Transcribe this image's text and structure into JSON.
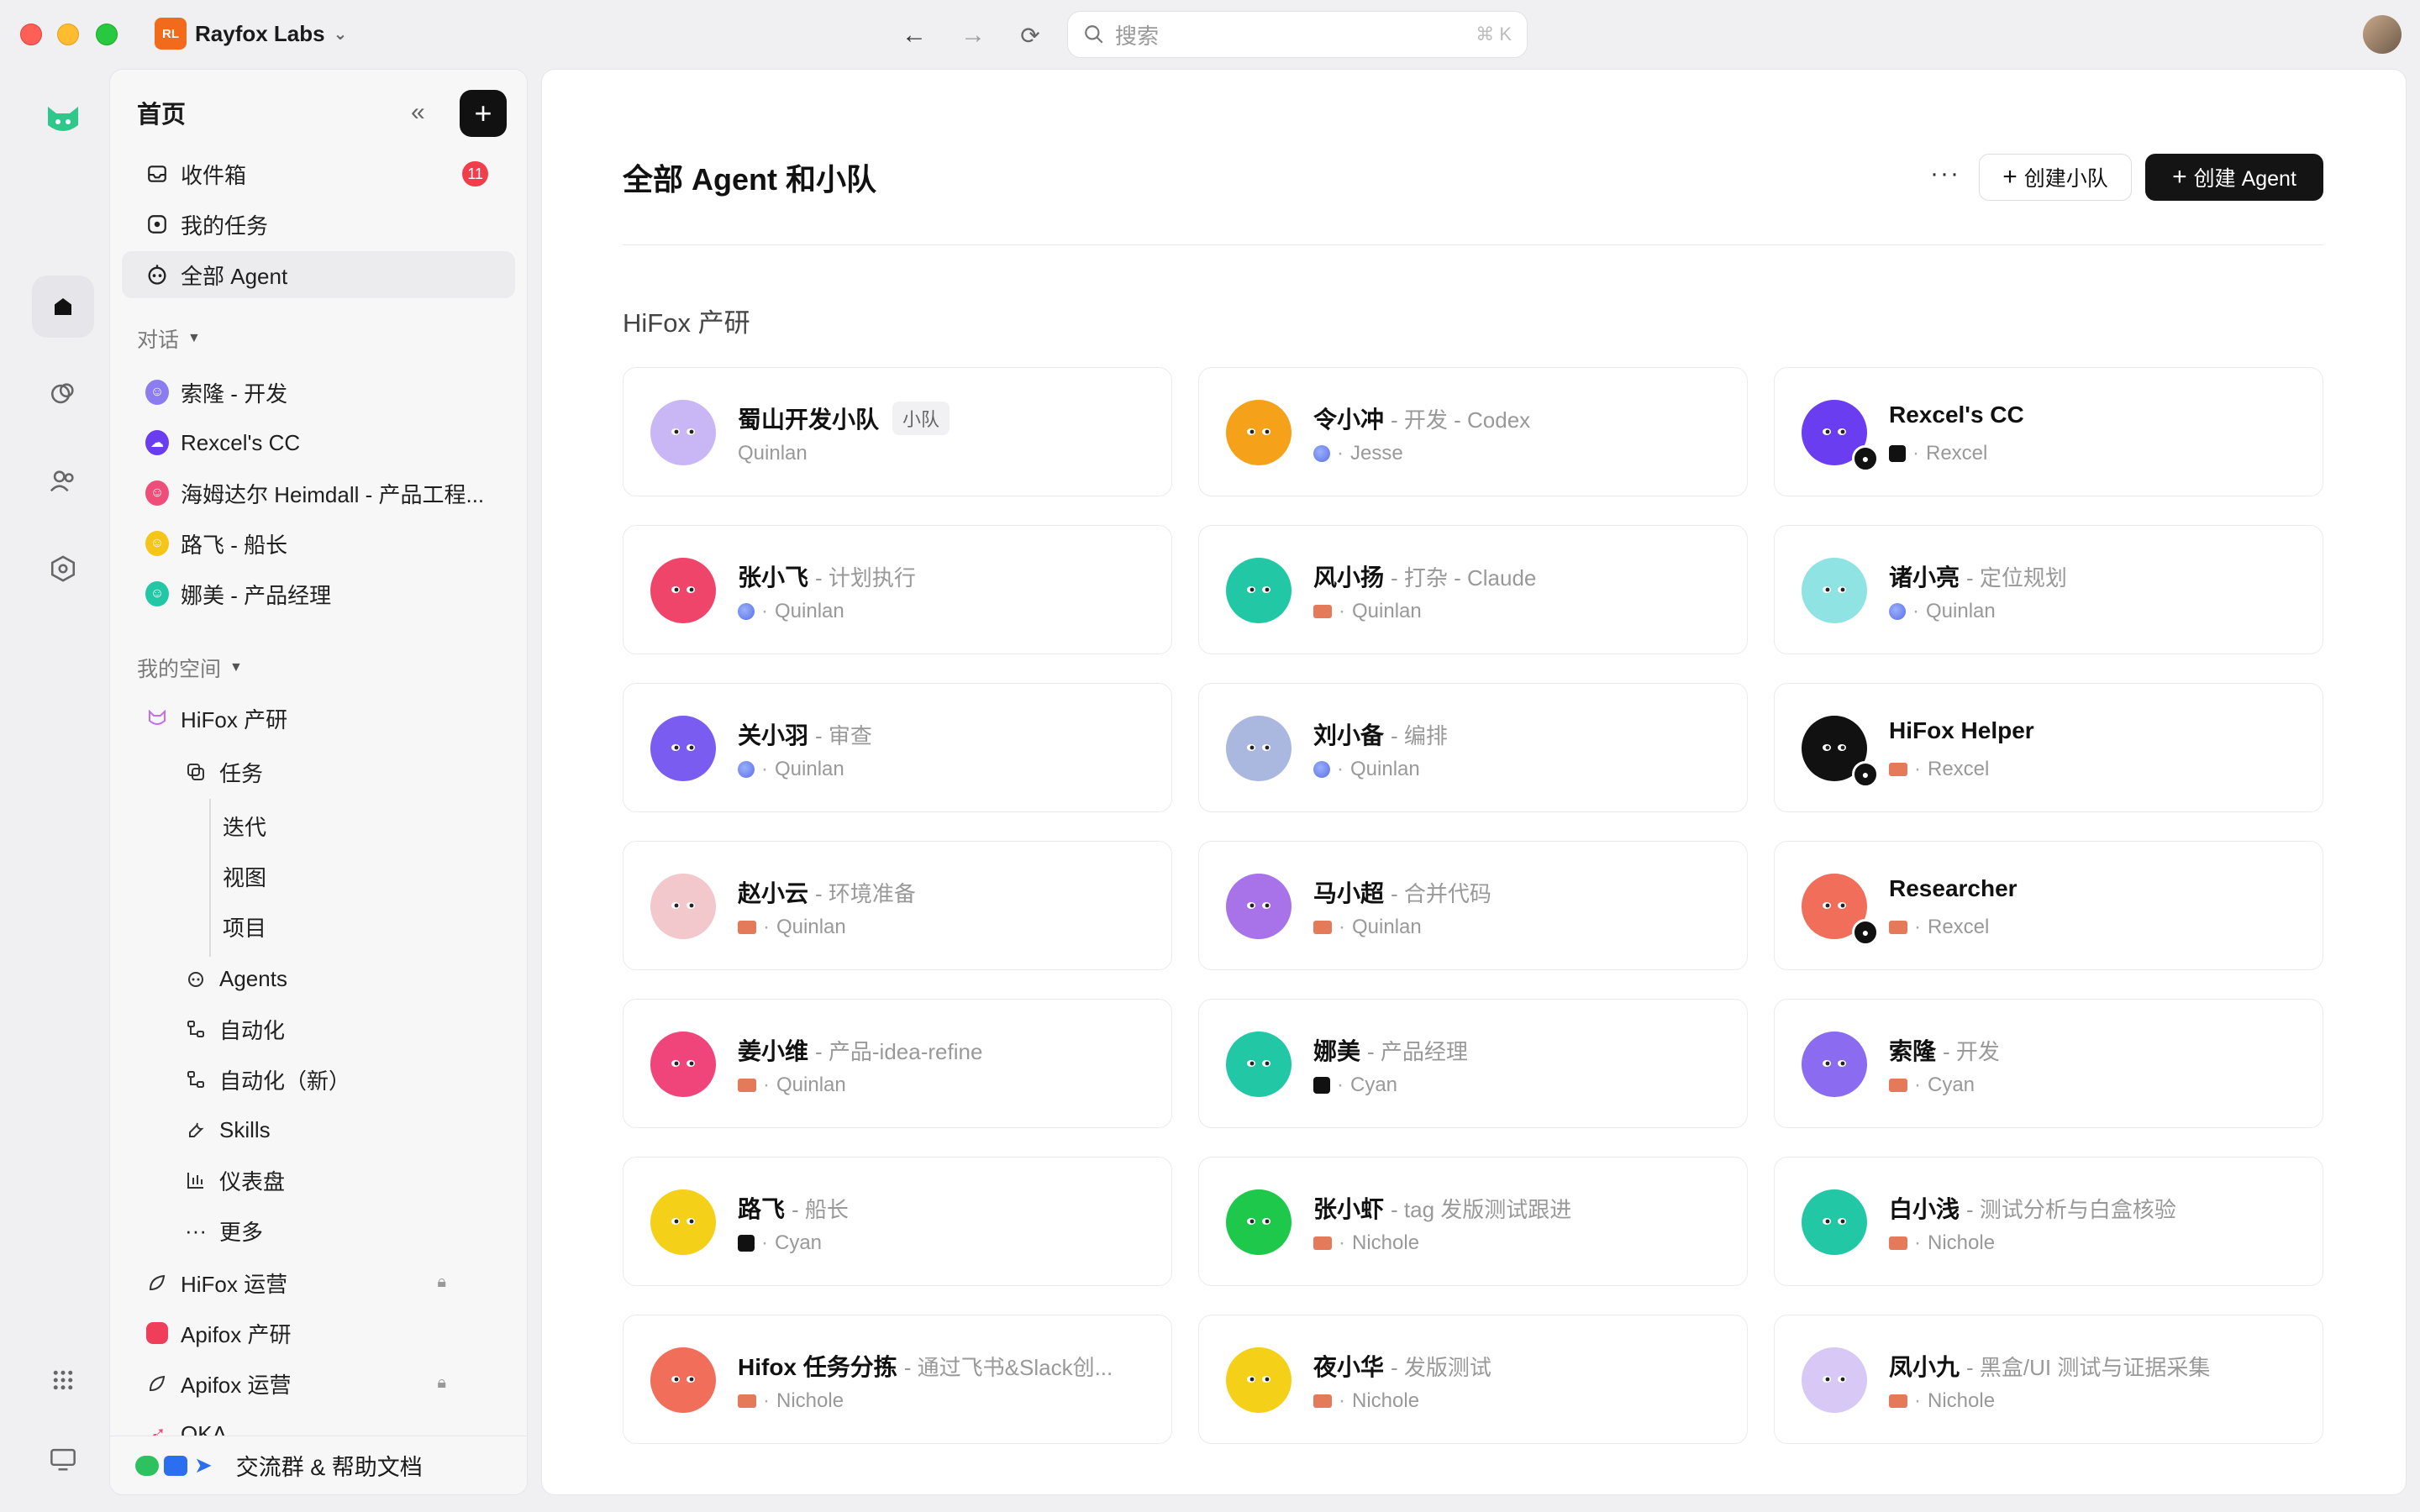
{
  "titlebar": {
    "workspace_initials": "RL",
    "workspace_name": "Rayfox Labs",
    "search_placeholder": "搜索",
    "search_shortcut": "⌘ K"
  },
  "sidebar": {
    "title": "首页",
    "top_items": [
      {
        "label": "收件箱",
        "badge": "11"
      },
      {
        "label": "我的任务"
      },
      {
        "label": "全部 Agent"
      }
    ],
    "chats_section": "对话",
    "chats": [
      {
        "label": "索隆 - 开发",
        "color": "#8b7cf0"
      },
      {
        "label": "Rexcel's CC",
        "color": "#6a3df0"
      },
      {
        "label": "海姆达尔 Heimdall - 产品工程...",
        "color": "#f04e7a"
      },
      {
        "label": "路飞 - 船长",
        "color": "#f5c518"
      },
      {
        "label": "娜美 - 产品经理",
        "color": "#22c8a5"
      }
    ],
    "space_section": "我的空间",
    "spaces": [
      {
        "label": "HiFox 产研"
      },
      {
        "label": "任务"
      },
      {
        "label": "迭代"
      },
      {
        "label": "视图"
      },
      {
        "label": "项目"
      },
      {
        "label": "Agents"
      },
      {
        "label": "自动化"
      },
      {
        "label": "自动化（新）"
      },
      {
        "label": "Skills"
      },
      {
        "label": "仪表盘"
      },
      {
        "label": "更多"
      },
      {
        "label": "HiFox 运营"
      },
      {
        "label": "Apifox 产研"
      },
      {
        "label": "Apifox 运营"
      },
      {
        "label": "OKA"
      }
    ],
    "footer": "交流群 & 帮助文档"
  },
  "main": {
    "title": "全部 Agent 和小队",
    "create_team": "创建小队",
    "create_agent": "创建 Agent",
    "group": "HiFox 产研",
    "cards": [
      {
        "name": "蜀山开发小队",
        "role": "",
        "tag": "小队",
        "owner": "Quinlan",
        "owner_icon": "none",
        "color": "#c9b7f5",
        "lock": false
      },
      {
        "name": "令小冲",
        "role": "- 开发 - Codex",
        "tag": "",
        "owner": "Jesse",
        "owner_icon": "blue",
        "color": "#f5a11a",
        "lock": false
      },
      {
        "name": "Rexcel's CC",
        "role": "",
        "tag": "",
        "owner": "Rexcel",
        "owner_icon": "px",
        "color": "#6a3df0",
        "lock": true
      },
      {
        "name": "张小飞",
        "role": "- 计划执行",
        "tag": "",
        "owner": "Quinlan",
        "owner_icon": "blue",
        "color": "#f0456a",
        "lock": false
      },
      {
        "name": "风小扬",
        "role": "- 打杂 - Claude",
        "tag": "",
        "owner": "Quinlan",
        "owner_icon": "bus",
        "color": "#22c8a5",
        "lock": false
      },
      {
        "name": "诸小亮",
        "role": "- 定位规划",
        "tag": "",
        "owner": "Quinlan",
        "owner_icon": "blue",
        "color": "#8fe3e3",
        "lock": false
      },
      {
        "name": "关小羽",
        "role": "- 审查",
        "tag": "",
        "owner": "Quinlan",
        "owner_icon": "blue",
        "color": "#7b5cf0",
        "lock": false
      },
      {
        "name": "刘小备",
        "role": "- 编排",
        "tag": "",
        "owner": "Quinlan",
        "owner_icon": "blue",
        "color": "#aab8e0",
        "lock": false
      },
      {
        "name": "HiFox Helper",
        "role": "",
        "tag": "",
        "owner": "Rexcel",
        "owner_icon": "bus",
        "color": "#111111",
        "lock": true
      },
      {
        "name": "赵小云",
        "role": "- 环境准备",
        "tag": "",
        "owner": "Quinlan",
        "owner_icon": "bus",
        "color": "#f2c8cc",
        "lock": false
      },
      {
        "name": "马小超",
        "role": "- 合并代码",
        "tag": "",
        "owner": "Quinlan",
        "owner_icon": "bus",
        "color": "#a872e8",
        "lock": false
      },
      {
        "name": "Researcher",
        "role": "",
        "tag": "",
        "owner": "Rexcel",
        "owner_icon": "bus",
        "color": "#f06e5a",
        "lock": true
      },
      {
        "name": "姜小维",
        "role": "- 产品-idea-refine",
        "tag": "",
        "owner": "Quinlan",
        "owner_icon": "bus",
        "color": "#f0457a",
        "lock": false
      },
      {
        "name": "娜美",
        "role": "- 产品经理",
        "tag": "",
        "owner": "Cyan",
        "owner_icon": "px",
        "color": "#22c8a5",
        "lock": false
      },
      {
        "name": "索隆",
        "role": "- 开发",
        "tag": "",
        "owner": "Cyan",
        "owner_icon": "bus",
        "color": "#8b6cf0",
        "lock": false
      },
      {
        "name": "路飞",
        "role": "- 船长",
        "tag": "",
        "owner": "Cyan",
        "owner_icon": "px",
        "color": "#f5d018",
        "lock": false
      },
      {
        "name": "张小虾",
        "role": "- tag 发版测试跟进",
        "tag": "",
        "owner": "Nichole",
        "owner_icon": "bus",
        "color": "#1ec84a",
        "lock": false
      },
      {
        "name": "白小浅",
        "role": "- 测试分析与白盒核验",
        "tag": "",
        "owner": "Nichole",
        "owner_icon": "bus",
        "color": "#22c8a5",
        "lock": false
      },
      {
        "name": "Hifox 任务分拣",
        "role": "- 通过飞书&Slack创...",
        "tag": "",
        "owner": "Nichole",
        "owner_icon": "bus",
        "color": "#f06e5a",
        "lock": false
      },
      {
        "name": "夜小华",
        "role": "- 发版测试",
        "tag": "",
        "owner": "Nichole",
        "owner_icon": "bus",
        "color": "#f5d018",
        "lock": false
      },
      {
        "name": "凤小九",
        "role": "- 黑盒/UI 测试与证据采集",
        "tag": "",
        "owner": "Nichole",
        "owner_icon": "bus",
        "color": "#d8c8f5",
        "lock": false
      }
    ]
  }
}
